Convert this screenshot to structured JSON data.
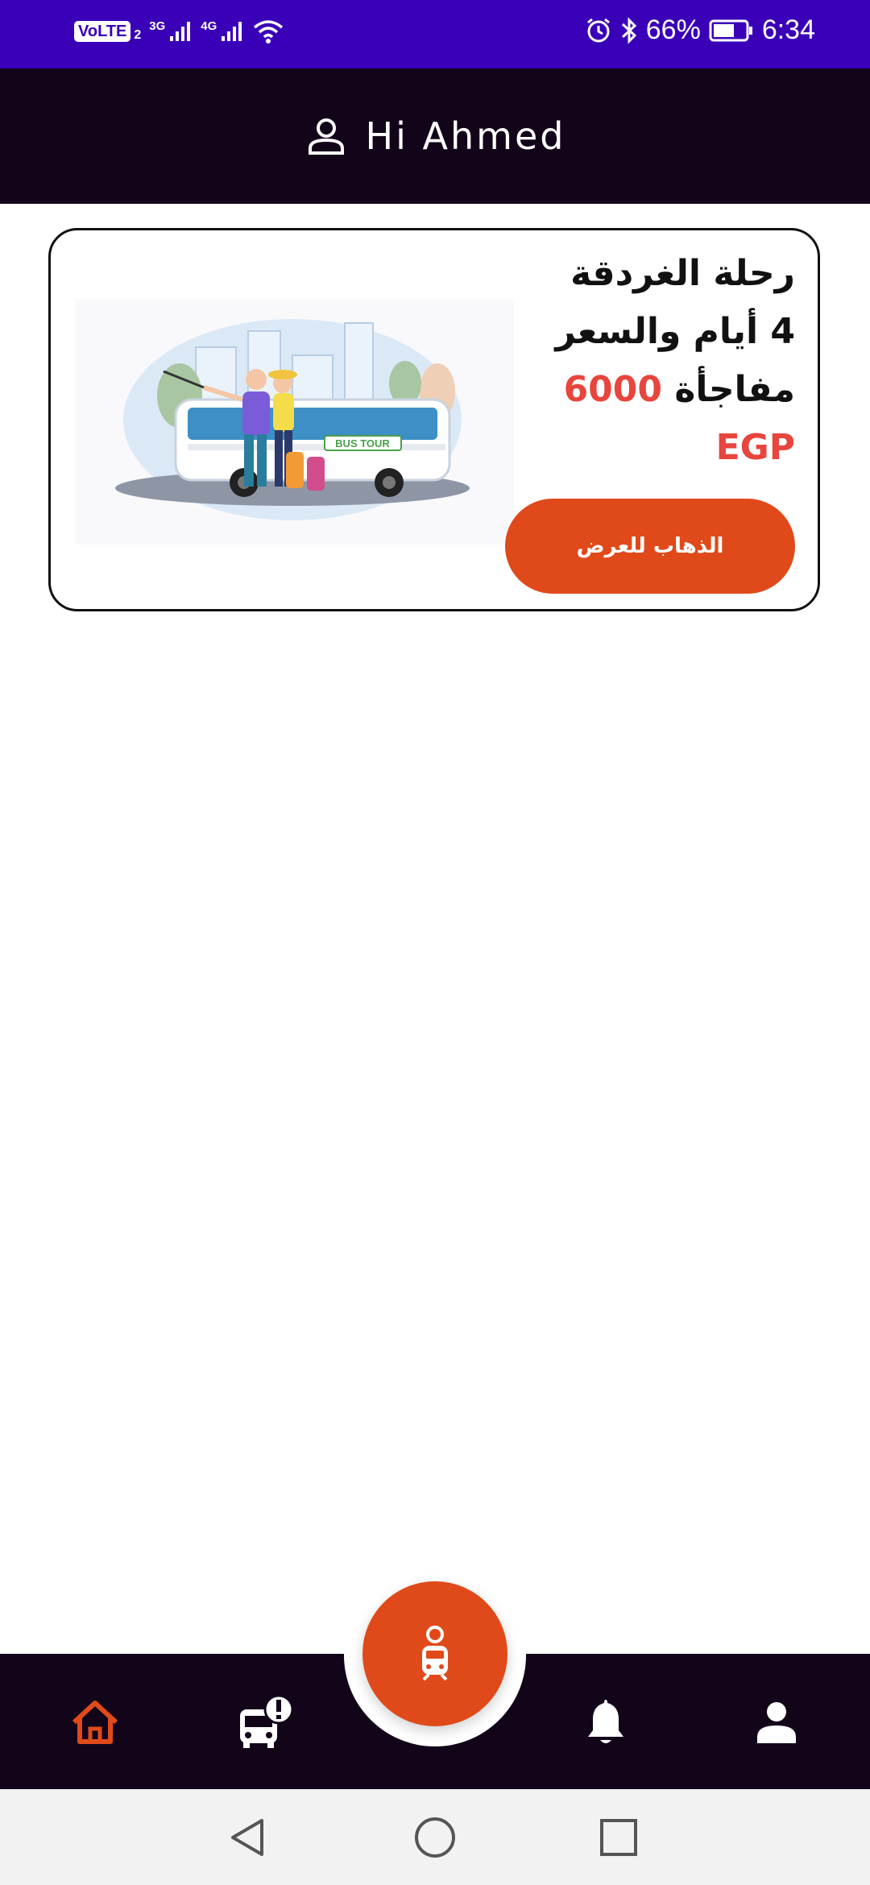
{
  "status_bar": {
    "volte_label": "VoLTE",
    "sim_slot": "2",
    "network_1": "3G",
    "network_2": "4G",
    "battery_percent": "66%",
    "battery_level": 0.66,
    "time": "6:34",
    "icons": [
      "signal-icon",
      "wifi-icon",
      "alarm-icon",
      "bluetooth-icon",
      "battery-icon"
    ]
  },
  "header": {
    "greeting": "Hi Ahmed",
    "icon": "user-outline-icon"
  },
  "offer": {
    "line1": "رحلة الغردقة",
    "line2": "4 أيام والسعر",
    "line3_text": "مفاجأة",
    "price_value": "6000",
    "currency": "EGP",
    "button_label": "الذهاب للعرض",
    "illustration_caption": "BUS TOUR"
  },
  "bottom_nav": {
    "items": [
      {
        "name": "home",
        "icon": "home-icon",
        "active": true
      },
      {
        "name": "bus-alert",
        "icon": "bus-alert-icon",
        "active": false
      },
      {
        "name": "notifications",
        "icon": "bell-icon",
        "active": false
      },
      {
        "name": "profile",
        "icon": "person-icon",
        "active": false
      }
    ],
    "fab_icon": "train-icon"
  },
  "colors": {
    "status_bar": "#3a00b8",
    "header_bg": "#12051a",
    "accent": "#e04a1a",
    "price": "#e8453c",
    "nav_active": "#e04a1a",
    "nav_inactive": "#ffffff"
  }
}
